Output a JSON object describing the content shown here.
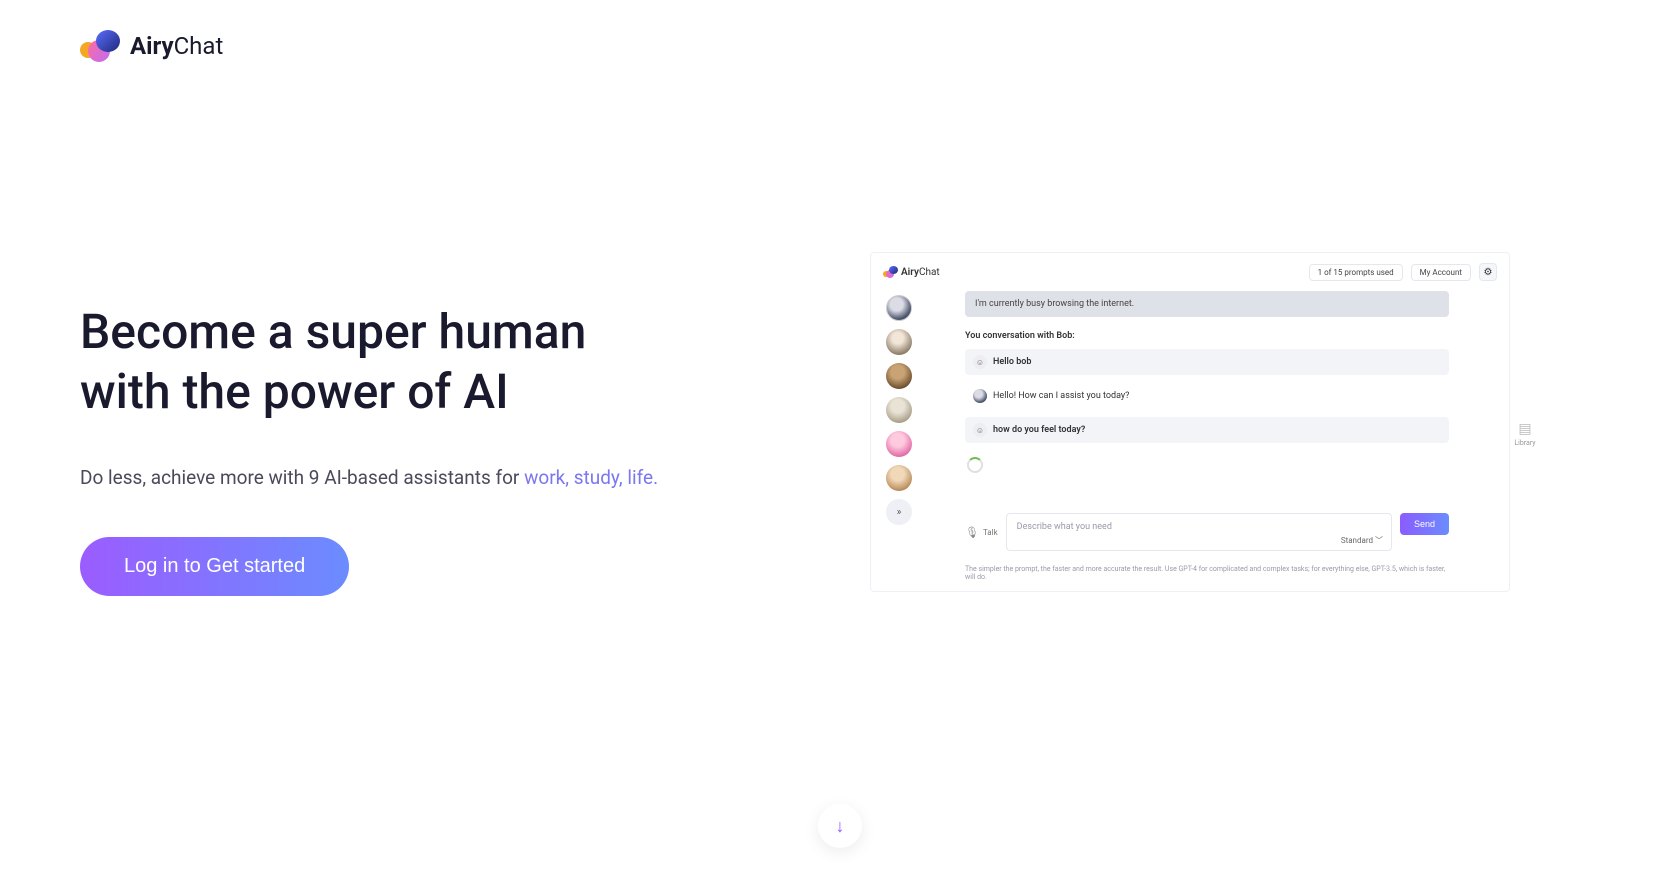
{
  "brand": {
    "bold": "Airy",
    "light": "Chat"
  },
  "hero": {
    "title_line1": "Become a super human",
    "title_line2": "with the power of AI",
    "sub_prefix": "Do less, achieve more with 9 AI-based assistants for ",
    "sub_accent": "work, study, life.",
    "cta": "Log in to Get started"
  },
  "mock": {
    "brand_bold": "Airy",
    "brand_light": "Chat",
    "usage": "1 of 15 prompts used",
    "account": "My Account",
    "gear_icon": "gear-icon",
    "banner": "I'm currently busy browsing the internet.",
    "conversation_label": "You conversation with Bob:",
    "messages": [
      {
        "role": "user",
        "text": "Hello bob"
      },
      {
        "role": "bot",
        "text": "Hello! How can I assist you today?"
      },
      {
        "role": "user",
        "text": "how do you feel today?"
      }
    ],
    "talk_label": "Talk",
    "placeholder": "Describe what you need",
    "send": "Send",
    "model": "Standard",
    "hint": "The simpler the prompt, the faster and more accurate the result. Use GPT-4 for complicated and complex tasks; for everything else, GPT-3.5, which is faster, will do.",
    "library": "Library",
    "expand_icon": "chevrons-right-icon"
  }
}
